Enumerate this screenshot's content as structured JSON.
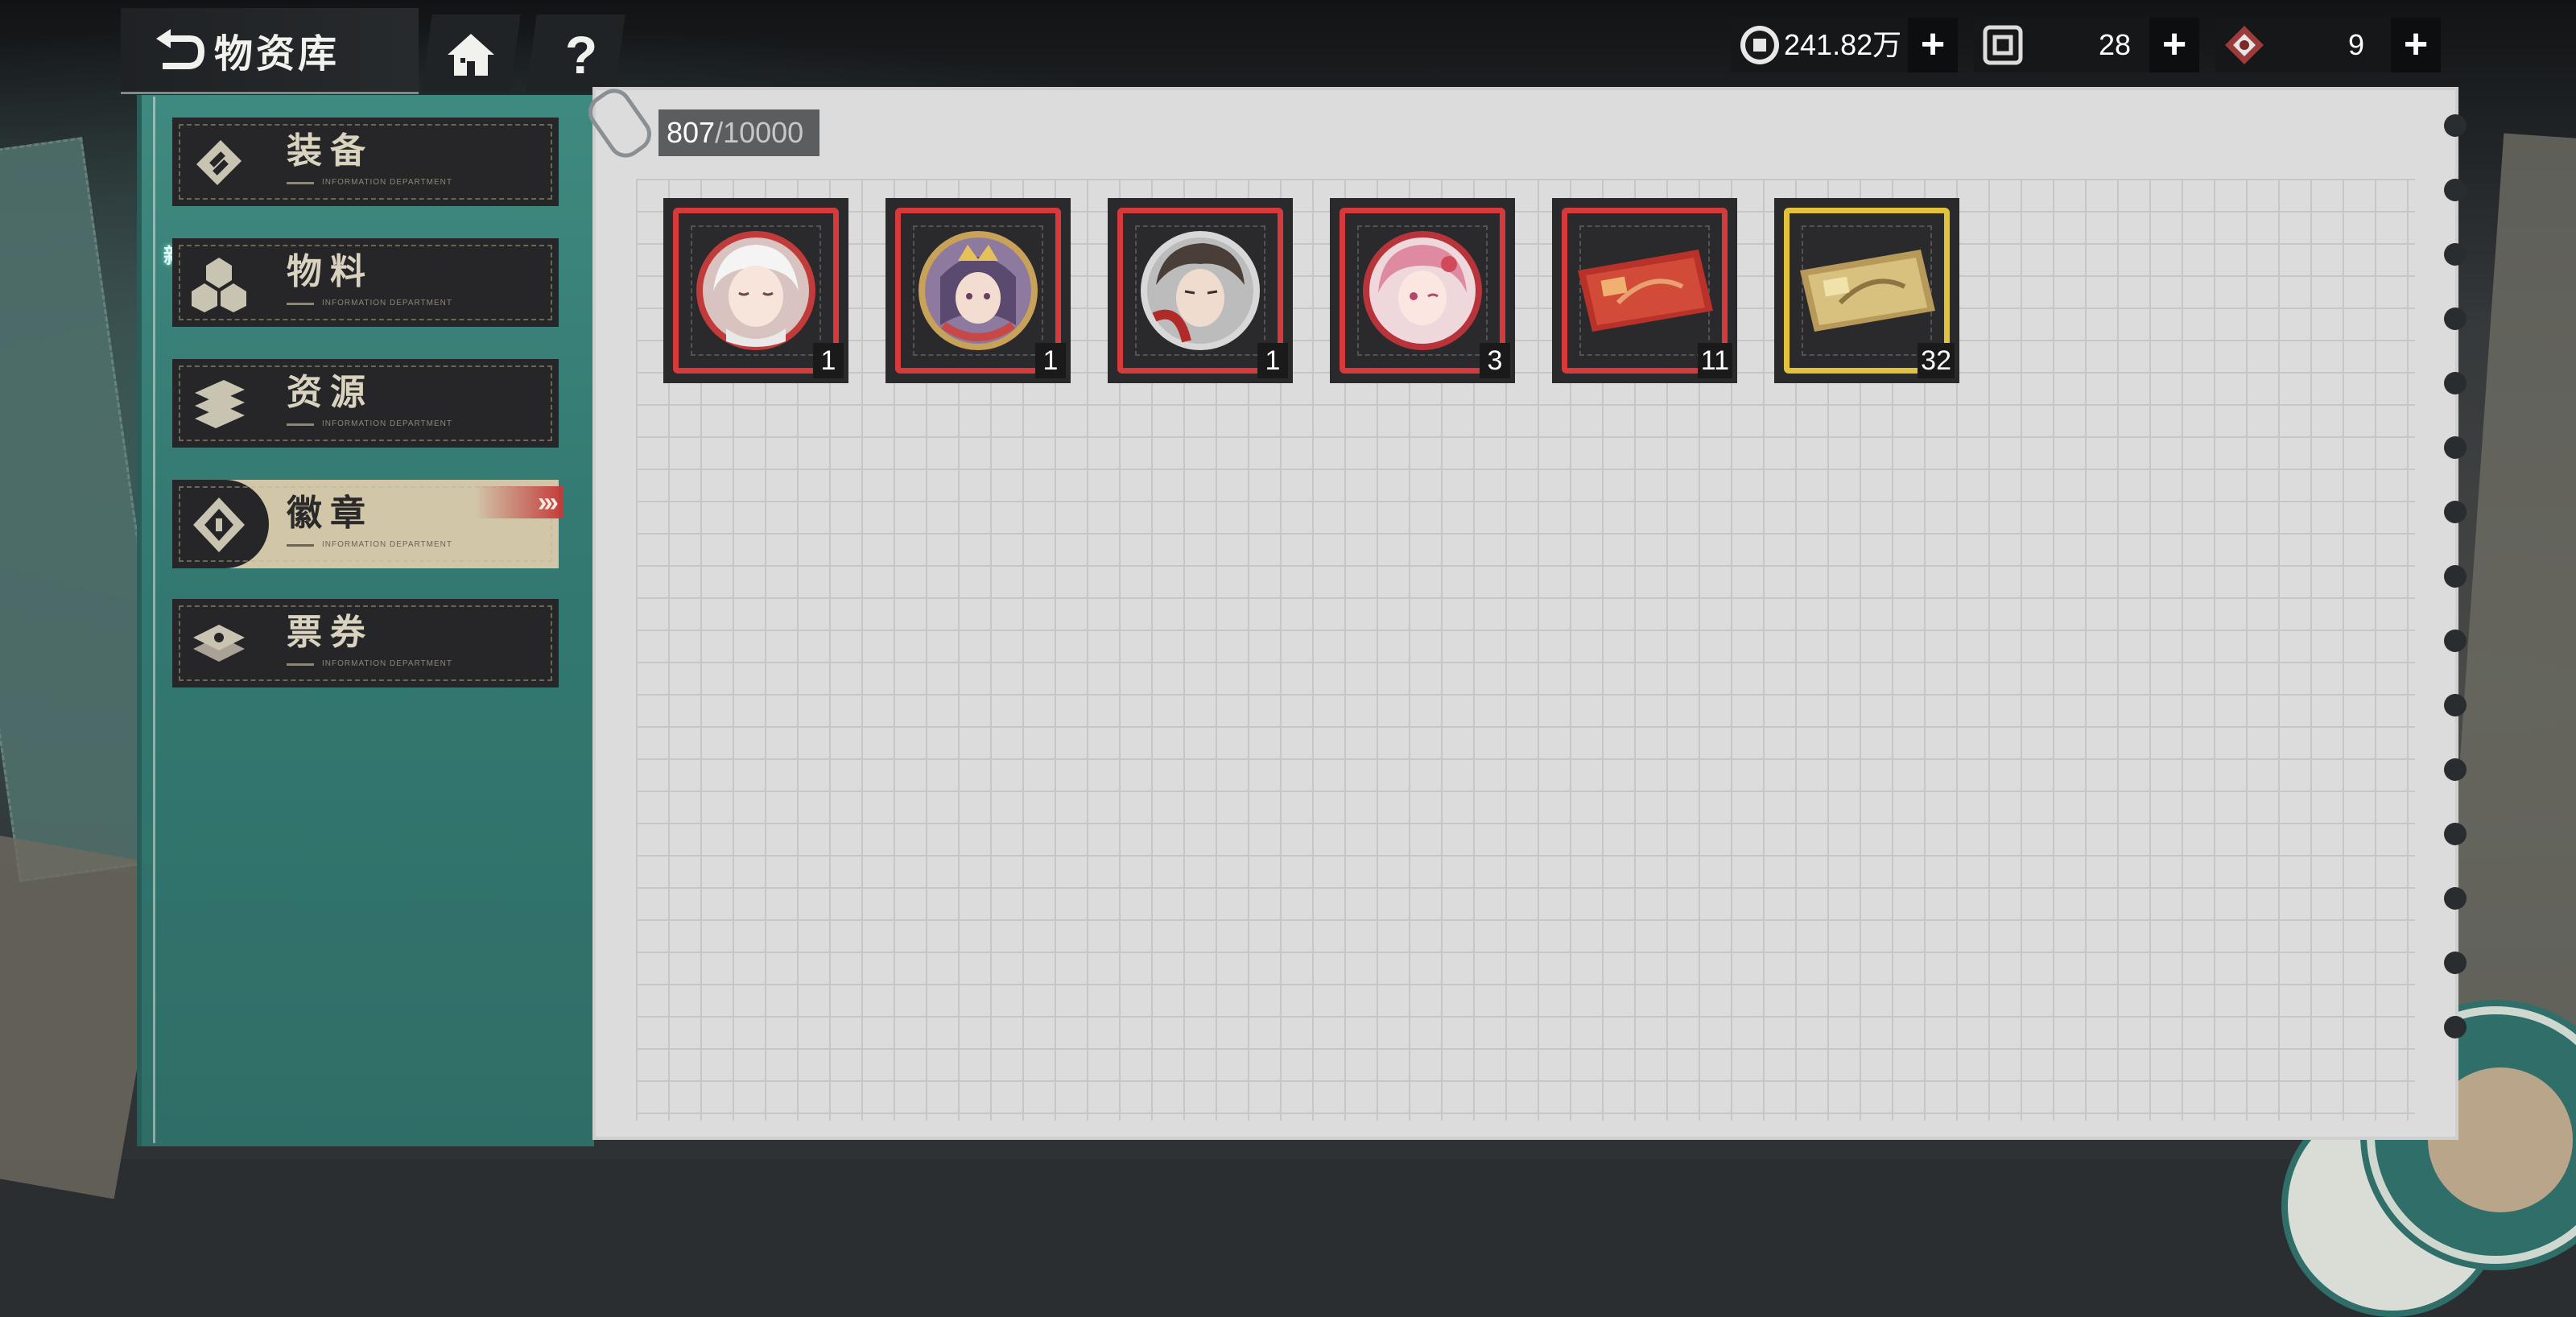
{
  "header": {
    "back_icon": "return-arrow-icon",
    "title": "物资库",
    "home_icon": "home-icon",
    "help_label": "?"
  },
  "currencies": [
    {
      "icon": "coin-icon",
      "value": "241.82万",
      "plus": "+"
    },
    {
      "icon": "token-icon",
      "value": "28",
      "plus": "+"
    },
    {
      "icon": "crystal-icon",
      "value": "9",
      "plus": "+"
    }
  ],
  "sidebar": {
    "new_badge": "新",
    "items": [
      {
        "label": "装备",
        "sub": "INFORMATION DEPARTMENT",
        "icon": "equipment-icon",
        "active": false
      },
      {
        "label": "物料",
        "sub": "INFORMATION DEPARTMENT",
        "icon": "materials-icon",
        "active": false
      },
      {
        "label": "资源",
        "sub": "INFORMATION DEPARTMENT",
        "icon": "resources-icon",
        "active": false
      },
      {
        "label": "徽章",
        "sub": "INFORMATION DEPARTMENT",
        "icon": "badge-icon",
        "active": true
      },
      {
        "label": "票券",
        "sub": "INFORMATION DEPARTMENT",
        "icon": "ticket-icon",
        "active": false
      }
    ],
    "active_arrows": "›››"
  },
  "inventory": {
    "count": "807",
    "max": "/10000",
    "items": [
      {
        "type": "badge",
        "character": "white-haired-character",
        "qty": "1",
        "rarity": "red"
      },
      {
        "type": "badge",
        "character": "crowned-character",
        "qty": "1",
        "rarity": "red"
      },
      {
        "type": "badge",
        "character": "dark-haired-character",
        "qty": "1",
        "rarity": "red"
      },
      {
        "type": "badge",
        "character": "pink-haired-character",
        "qty": "3",
        "rarity": "red"
      },
      {
        "type": "ticket",
        "character": "red-ticket",
        "qty": "11",
        "rarity": "red"
      },
      {
        "type": "ticket",
        "character": "gold-ticket",
        "qty": "32",
        "rarity": "gold"
      }
    ]
  },
  "colors": {
    "sidebar": "#3f8a80",
    "active_tab": "#d1c6a8",
    "frame_red": "#d63a3a",
    "frame_gold": "#e2c23a"
  }
}
